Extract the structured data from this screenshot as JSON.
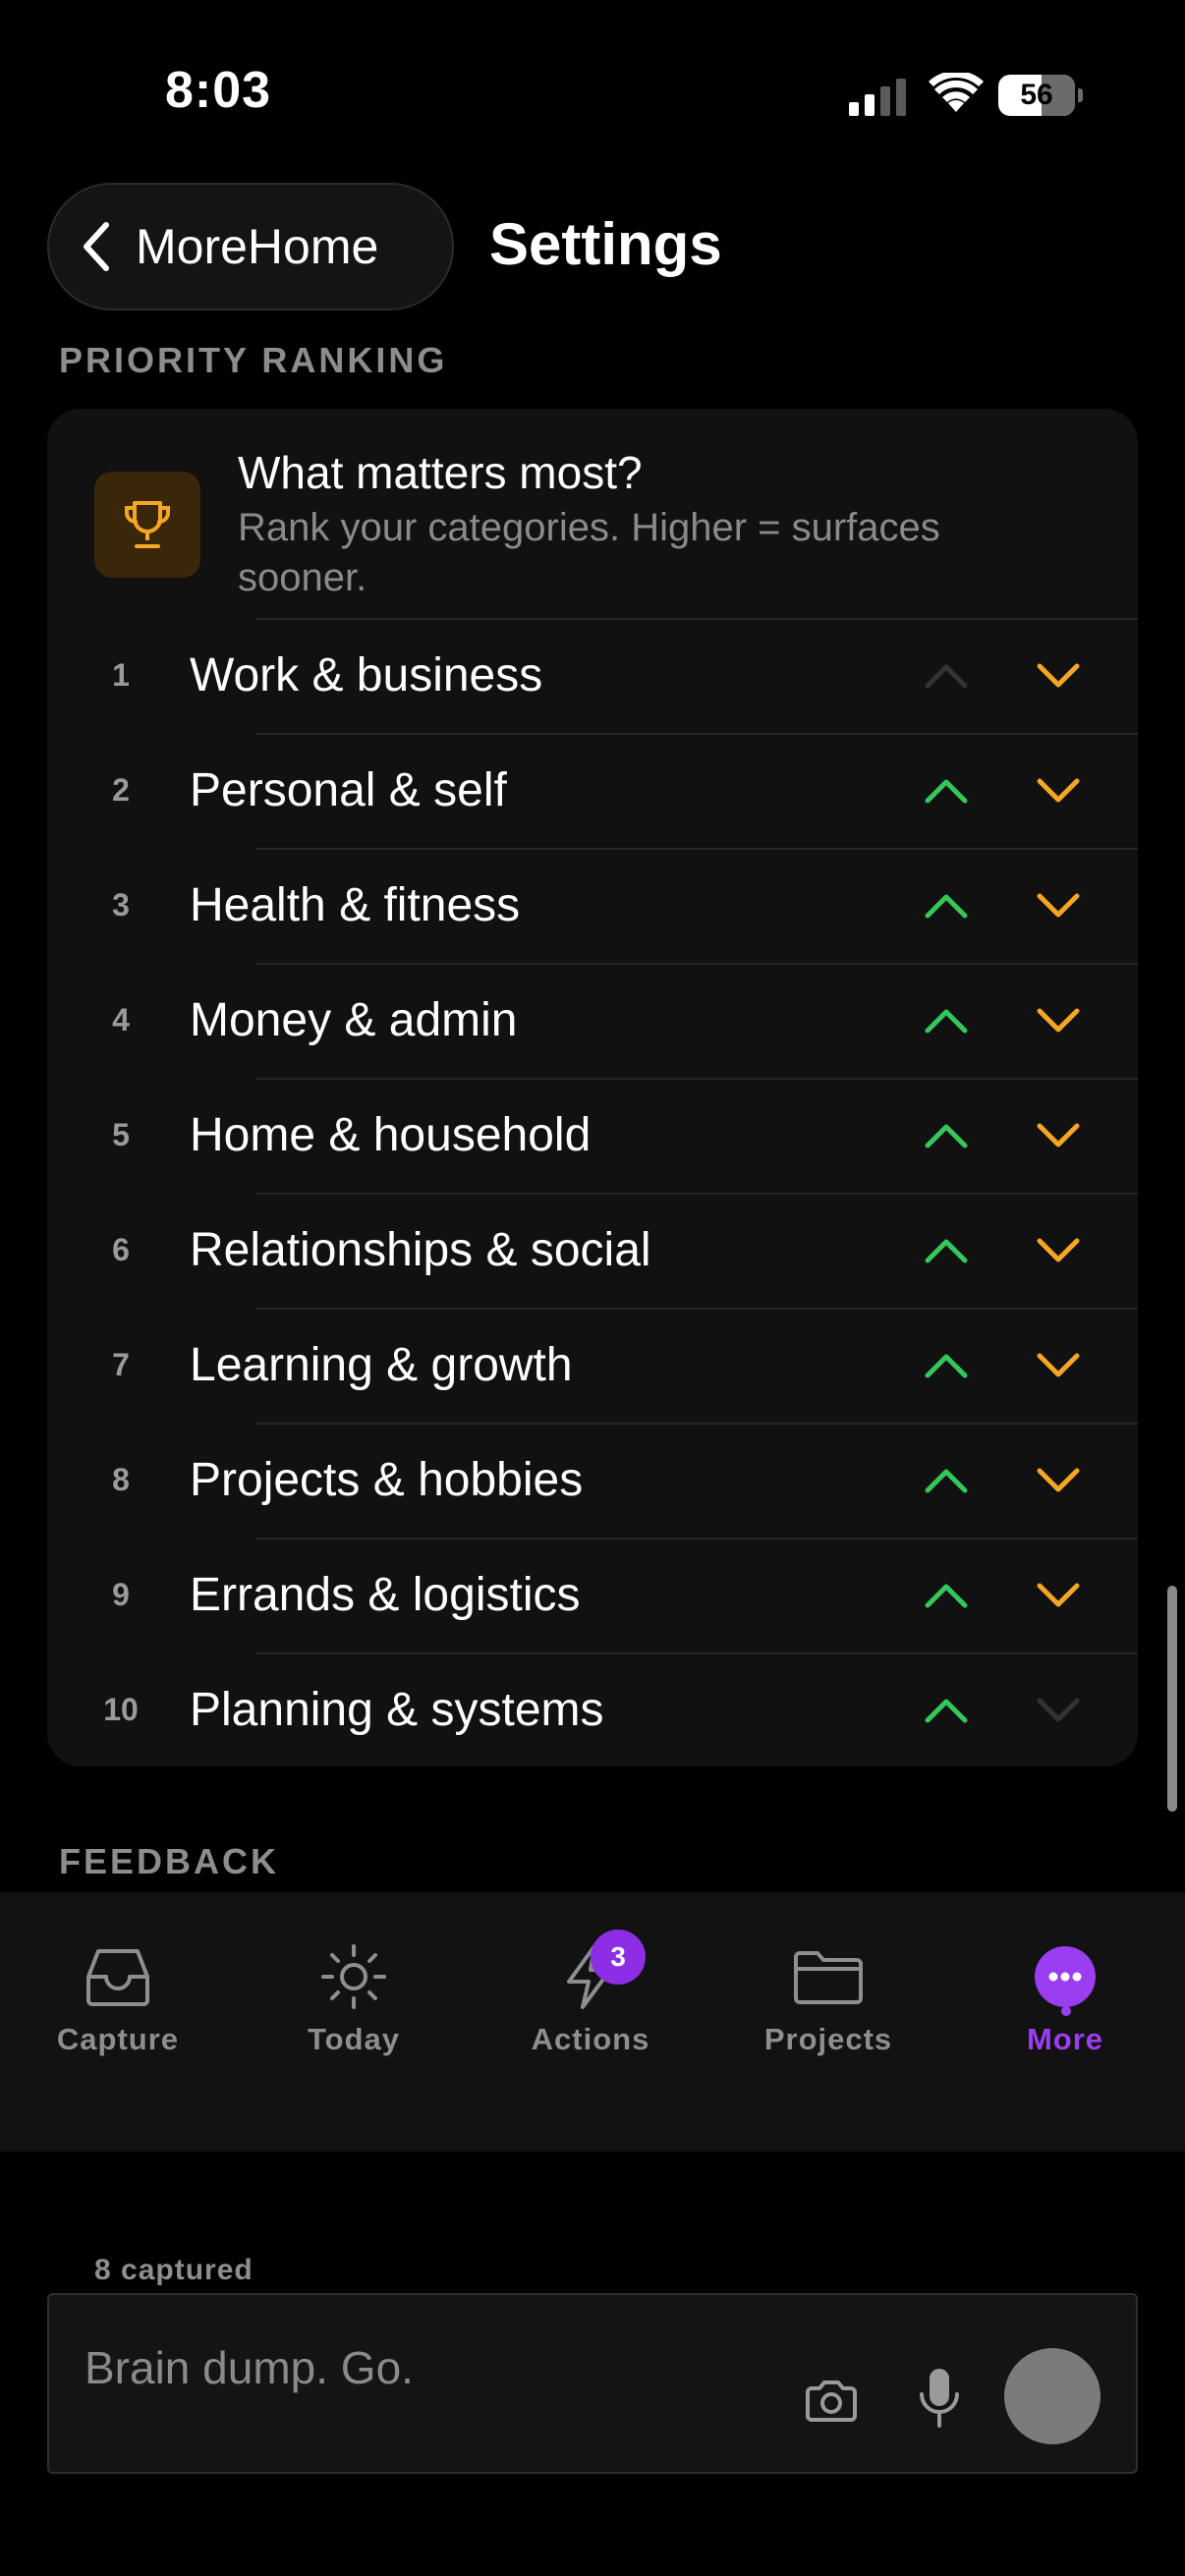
{
  "status_bar": {
    "time": "8:03",
    "battery": "56",
    "battery_level": 0.56,
    "signal_bars": 2,
    "signal_total": 4
  },
  "header": {
    "back_label": "MoreHome",
    "title": "Settings"
  },
  "priority_section": {
    "label": "PRIORITY RANKING",
    "title": "What matters most?",
    "description": "Rank your categories. Higher = surfaces sooner.",
    "items": [
      {
        "rank": "1",
        "label": "Work & business",
        "up_enabled": false,
        "down_enabled": true
      },
      {
        "rank": "2",
        "label": "Personal & self",
        "up_enabled": true,
        "down_enabled": true
      },
      {
        "rank": "3",
        "label": "Health & fitness",
        "up_enabled": true,
        "down_enabled": true
      },
      {
        "rank": "4",
        "label": "Money & admin",
        "up_enabled": true,
        "down_enabled": true
      },
      {
        "rank": "5",
        "label": "Home & household",
        "up_enabled": true,
        "down_enabled": true
      },
      {
        "rank": "6",
        "label": "Relationships & social",
        "up_enabled": true,
        "down_enabled": true
      },
      {
        "rank": "7",
        "label": "Learning & growth",
        "up_enabled": true,
        "down_enabled": true
      },
      {
        "rank": "8",
        "label": "Projects & hobbies",
        "up_enabled": true,
        "down_enabled": true
      },
      {
        "rank": "9",
        "label": "Errands & logistics",
        "up_enabled": true,
        "down_enabled": true
      },
      {
        "rank": "10",
        "label": "Planning & systems",
        "up_enabled": true,
        "down_enabled": false
      }
    ]
  },
  "feedback_section": {
    "label": "FEEDBACK"
  },
  "tab_bar": {
    "tabs": [
      {
        "label": "Capture",
        "icon": "inbox-icon"
      },
      {
        "label": "Today",
        "icon": "sun-icon"
      },
      {
        "label": "Actions",
        "icon": "lightning-icon",
        "badge": "3"
      },
      {
        "label": "Projects",
        "icon": "folder-icon"
      },
      {
        "label": "More",
        "icon": "more-icon",
        "active": true
      }
    ]
  },
  "capture": {
    "count_label": "8 captured",
    "placeholder": "Brain dump. Go."
  },
  "colors": {
    "accent": "#9b3df0",
    "up_arrow": "#34c759",
    "down_arrow": "#f5a623",
    "trophy": "#f5a623"
  }
}
